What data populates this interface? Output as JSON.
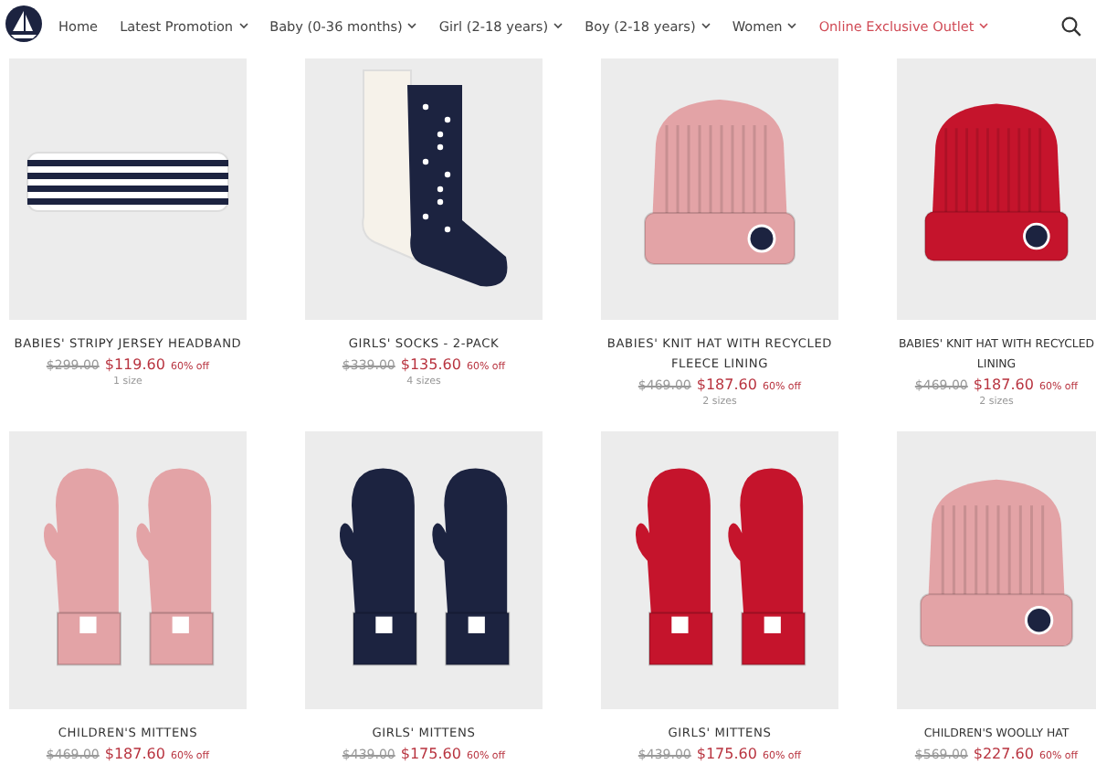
{
  "nav": {
    "items": [
      {
        "label": "Home",
        "dropdown": false,
        "highlighted": false
      },
      {
        "label": "Latest Promotion",
        "dropdown": true,
        "highlighted": false
      },
      {
        "label": "Baby (0-36 months)",
        "dropdown": true,
        "highlighted": false
      },
      {
        "label": "Girl (2-18 years)",
        "dropdown": true,
        "highlighted": false
      },
      {
        "label": "Boy (2-18 years)",
        "dropdown": true,
        "highlighted": false
      },
      {
        "label": "Women",
        "dropdown": true,
        "highlighted": false
      },
      {
        "label": "Online Exclusive Outlet",
        "dropdown": true,
        "highlighted": true
      }
    ]
  },
  "products": [
    {
      "kind": "headband",
      "color": "#1c2340",
      "title": "BABIES' STRIPY JERSEY HEADBAND",
      "old_price": "$299.00",
      "price": "$119.60",
      "discount": "60% off",
      "sizes": "1 size"
    },
    {
      "kind": "socks",
      "color": "#1c2340",
      "title": "GIRLS' SOCKS - 2-PACK",
      "old_price": "$339.00",
      "price": "$135.60",
      "discount": "60% off",
      "sizes": "4 sizes"
    },
    {
      "kind": "hat",
      "color": "#e3a3a6",
      "title": "BABIES' KNIT HAT WITH RECYCLED FLEECE LINING",
      "old_price": "$469.00",
      "price": "$187.60",
      "discount": "60% off",
      "sizes": "2 sizes"
    },
    {
      "kind": "hat",
      "color": "#c5142c",
      "title": "BABIES' KNIT HAT WITH RECYCLED LINING",
      "old_price": "$469.00",
      "price": "$187.60",
      "discount": "60% off",
      "sizes": "2 sizes"
    },
    {
      "kind": "mittens",
      "color": "#e3a3a6",
      "title": "CHILDREN'S MITTENS",
      "old_price": "$469.00",
      "price": "$187.60",
      "discount": "60% off"
    },
    {
      "kind": "mittens",
      "color": "#1c2340",
      "title": "GIRLS' MITTENS",
      "old_price": "$439.00",
      "price": "$175.60",
      "discount": "60% off"
    },
    {
      "kind": "mittens",
      "color": "#c5142c",
      "title": "GIRLS' MITTENS",
      "old_price": "$439.00",
      "price": "$175.60",
      "discount": "60% off"
    },
    {
      "kind": "hat",
      "color": "#e3a3a6",
      "title": "CHILDREN'S WOOLLY HAT",
      "old_price": "$569.00",
      "price": "$227.60",
      "discount": "60% off"
    }
  ]
}
